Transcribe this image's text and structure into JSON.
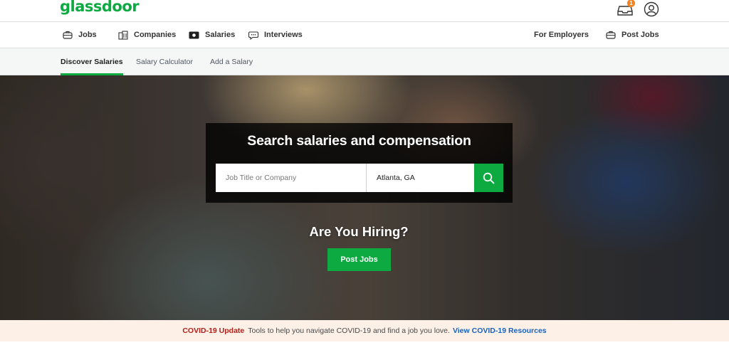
{
  "brand": {
    "logo": "glassdoor",
    "accent_color": "#0caa41"
  },
  "header": {
    "inbox_icon": "inbox-icon",
    "notification_count": "1",
    "account_icon": "user-circle-icon"
  },
  "main_nav": {
    "items": [
      {
        "label": "Jobs",
        "icon": "briefcase-icon"
      },
      {
        "label": "Companies",
        "icon": "building-icon"
      },
      {
        "label": "Salaries",
        "icon": "money-icon"
      },
      {
        "label": "Interviews",
        "icon": "chat-icon"
      }
    ],
    "right_items": [
      {
        "label": "For Employers"
      },
      {
        "label": "Post Jobs",
        "icon": "briefcase-icon"
      }
    ]
  },
  "sub_nav": {
    "items": [
      {
        "label": "Discover Salaries",
        "active": true
      },
      {
        "label": "Salary Calculator",
        "active": false
      },
      {
        "label": "Add a Salary",
        "active": false
      }
    ]
  },
  "hero": {
    "search_title": "Search salaries and compensation",
    "keyword_placeholder": "Job Title or Company",
    "location_value": "Atlanta, GA",
    "search_icon": "search-icon",
    "hiring_heading": "Are You Hiring?",
    "post_jobs_label": "Post Jobs"
  },
  "covid_banner": {
    "title": "COVID-19 Update",
    "text": "Tools to help you navigate COVID-19 and find a job you love.",
    "link": "View COVID-19 Resources",
    "title_color": "#b0201b",
    "link_color": "#1861bf"
  }
}
